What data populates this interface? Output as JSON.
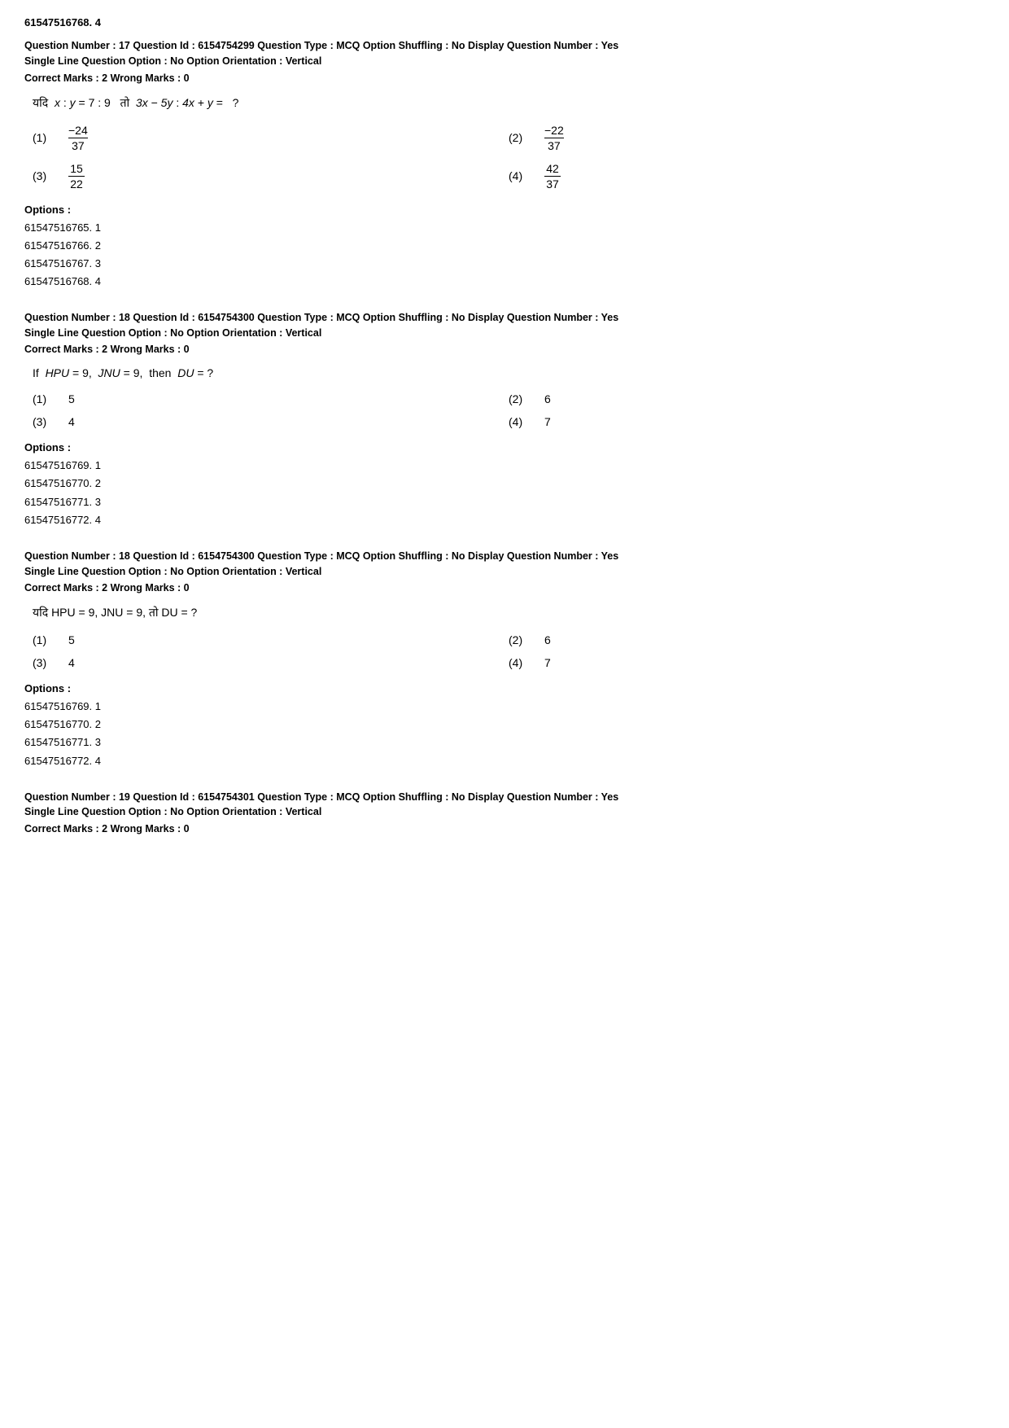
{
  "page": {
    "header_id": "61547516768. 4",
    "questions": [
      {
        "id": "q17",
        "meta_line1": "Question Number : 17  Question Id : 6154754299  Question Type : MCQ  Option Shuffling : No  Display Question Number : Yes",
        "meta_line2": "Single Line Question Option : No  Option Orientation : Vertical",
        "marks": "Correct Marks : 2  Wrong Marks : 0",
        "question_text": "यदि  x : y = 7 : 9  तो  3x − 5y : 4x + y =  ?",
        "options": [
          {
            "num": "(1)",
            "value": "-24/37",
            "type": "fraction",
            "numer": "−24",
            "denom": "37"
          },
          {
            "num": "(2)",
            "value": "-22/37",
            "type": "fraction",
            "numer": "−22",
            "denom": "37"
          },
          {
            "num": "(3)",
            "value": "15/22",
            "type": "fraction",
            "numer": "15",
            "denom": "22"
          },
          {
            "num": "(4)",
            "value": "42/37",
            "type": "fraction",
            "numer": "42",
            "denom": "37"
          }
        ],
        "options_label": "Options :",
        "options_ids": [
          "61547516765. 1",
          "61547516766. 2",
          "61547516767. 3",
          "61547516768. 4"
        ]
      },
      {
        "id": "q18a",
        "meta_line1": "Question Number : 18  Question Id : 6154754300  Question Type : MCQ  Option Shuffling : No  Display Question Number : Yes",
        "meta_line2": "Single Line Question Option : No  Option Orientation : Vertical",
        "marks": "Correct Marks : 2  Wrong Marks : 0",
        "question_text": "If  HPU = 9,  JNU = 9,  then  DU = ?",
        "options": [
          {
            "num": "(1)",
            "value": "5",
            "type": "text"
          },
          {
            "num": "(2)",
            "value": "6",
            "type": "text"
          },
          {
            "num": "(3)",
            "value": "4",
            "type": "text"
          },
          {
            "num": "(4)",
            "value": "7",
            "type": "text"
          }
        ],
        "options_label": "Options :",
        "options_ids": [
          "61547516769. 1",
          "61547516770. 2",
          "61547516771. 3",
          "61547516772. 4"
        ]
      },
      {
        "id": "q18b",
        "meta_line1": "Question Number : 18  Question Id : 6154754300  Question Type : MCQ  Option Shuffling : No  Display Question Number : Yes",
        "meta_line2": "Single Line Question Option : No  Option Orientation : Vertical",
        "marks": "Correct Marks : 2  Wrong Marks : 0",
        "question_text": "यदि HPU = 9, JNU = 9, तो DU = ?",
        "options": [
          {
            "num": "(1)",
            "value": "5",
            "type": "text"
          },
          {
            "num": "(2)",
            "value": "6",
            "type": "text"
          },
          {
            "num": "(3)",
            "value": "4",
            "type": "text"
          },
          {
            "num": "(4)",
            "value": "7",
            "type": "text"
          }
        ],
        "options_label": "Options :",
        "options_ids": [
          "61547516769. 1",
          "61547516770. 2",
          "61547516771. 3",
          "61547516772. 4"
        ]
      },
      {
        "id": "q19",
        "meta_line1": "Question Number : 19  Question Id : 6154754301  Question Type : MCQ  Option Shuffling : No  Display Question Number : Yes",
        "meta_line2": "Single Line Question Option : No  Option Orientation : Vertical",
        "marks": "Correct Marks : 2  Wrong Marks : 0",
        "question_text": "",
        "options": [],
        "options_label": "",
        "options_ids": []
      }
    ]
  }
}
